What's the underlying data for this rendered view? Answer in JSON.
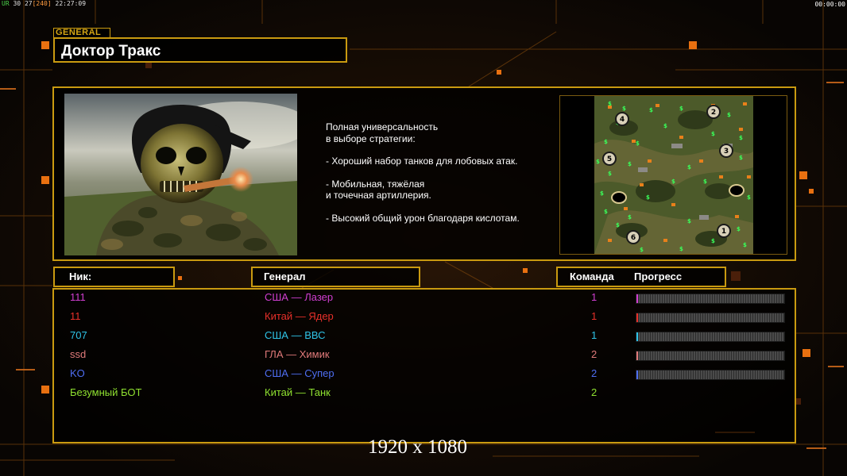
{
  "debug": {
    "prefix": "UR",
    "fps": "30",
    "frames": "27",
    "bracket": "[240]",
    "clock": "22:27:09",
    "timer": "00:00:00"
  },
  "general": {
    "tag": "GENERAL",
    "name": "Доктор Тракс",
    "description": [
      [
        "Полная универсальность",
        "в выборе стратегии:"
      ],
      [
        "- Хороший набор танков для лобовых атак."
      ],
      [
        "- Мобильная, тяжёлая",
        "и точечная артиллерия."
      ],
      [
        "- Высокий общий урон благодаря кислотам."
      ]
    ]
  },
  "map": {
    "start_positions": [
      "1",
      "2",
      "3",
      "4",
      "5",
      "6"
    ]
  },
  "headers": {
    "nick": "Ник:",
    "general": "Генерал",
    "team": "Команда",
    "progress": "Прогресс"
  },
  "players": [
    {
      "nick": "111",
      "general": "США — Лазер",
      "team": "1",
      "color": "#d13fd1",
      "progress": 0.012
    },
    {
      "nick": "11",
      "general": "Китай — Ядер",
      "team": "1",
      "color": "#e8302a",
      "progress": 0.01
    },
    {
      "nick": "707",
      "general": "США — ВВС",
      "team": "1",
      "color": "#2fc4e8",
      "progress": 0.01
    },
    {
      "nick": "ssd",
      "general": "ГЛА — Химик",
      "team": "2",
      "color": "#e07a7a",
      "progress": 0.01
    },
    {
      "nick": "KO",
      "general": "США — Супер",
      "team": "2",
      "color": "#4e6ef2",
      "progress": 0.01
    },
    {
      "nick": "Безумный БОТ",
      "general": "Китай — Танк",
      "team": "2",
      "color": "#8fe030",
      "progress": null
    }
  ],
  "resolution": "1920 x 1080"
}
